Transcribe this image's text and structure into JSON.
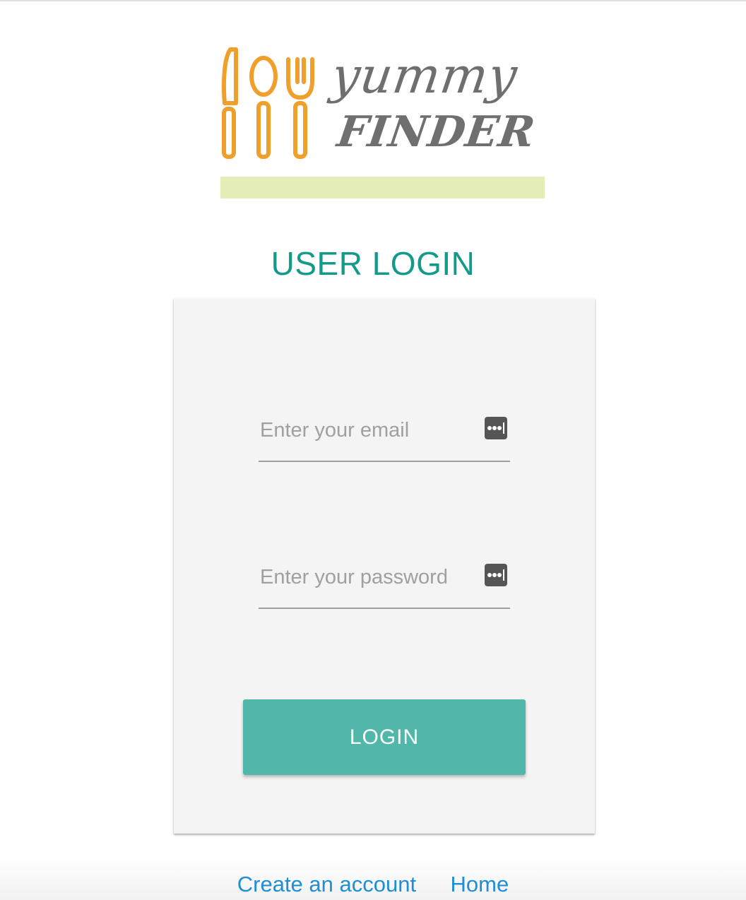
{
  "logo": {
    "line1": "yummy",
    "line2": "FINDER",
    "utensil_color": "#f0a02a",
    "bar_color": "#e6eeb8"
  },
  "page_title": "USER LOGIN",
  "form": {
    "email_placeholder": "Enter your email",
    "email_value": "",
    "password_placeholder": "Enter your password",
    "password_value": "",
    "field_icon": "password-manager-key-icon",
    "login_label": "LOGIN"
  },
  "links": {
    "create_account": "Create an account",
    "home": "Home"
  },
  "colors": {
    "title": "#139a8a",
    "button": "#52b7ab",
    "link": "#1e8fd6"
  }
}
